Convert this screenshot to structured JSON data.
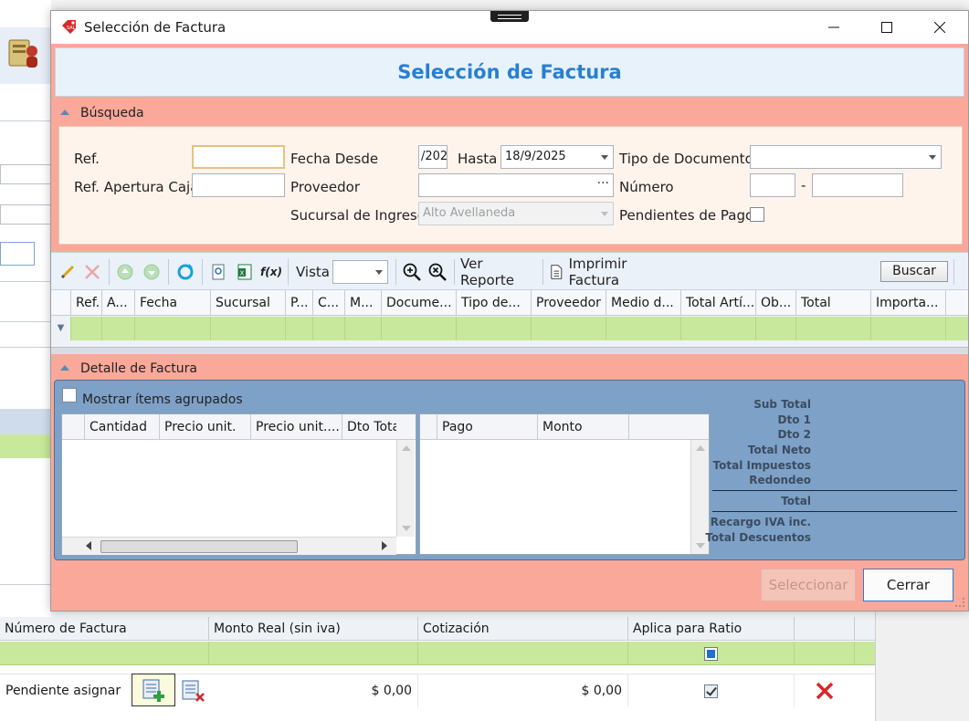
{
  "dialog": {
    "title": "Selección de Factura",
    "header": "Selección de Factura",
    "controls": {
      "minimize": "minimize",
      "maximize": "maximize",
      "close": "close"
    }
  },
  "search": {
    "section_title": "Búsqueda",
    "ref_label": "Ref.",
    "ref_value": "",
    "ref_apertura_label": "Ref. Apertura Caja",
    "ref_apertura_value": "",
    "fecha_desde_label": "Fecha Desde",
    "fecha_desde_value": "/202",
    "hasta_label": "Hasta",
    "hasta_value": "18/9/2025",
    "proveedor_label": "Proveedor",
    "proveedor_value": "",
    "proveedor_dots": "···",
    "sucursal_label": "Sucursal de Ingreso",
    "sucursal_value": "Alto Avellaneda",
    "tipo_doc_label": "Tipo de Documento",
    "tipo_doc_value": "",
    "numero_label": "Número",
    "numero_sep": "-",
    "pendientes_label": "Pendientes de Pago"
  },
  "toolbar": {
    "icons": [
      "pencil-icon",
      "delete-icon",
      "up-icon",
      "down-icon",
      "refresh-icon",
      "preview-icon",
      "excel-icon",
      "formula-icon",
      "zoom-in-icon",
      "zoom-out-icon",
      "print-icon"
    ],
    "formula_label": "f(x)",
    "vista_label": "Vista",
    "vista_value": "",
    "ver_reporte": "Ver Reporte",
    "imprimir": "Imprimir Factura",
    "buscar": "Buscar"
  },
  "invoice_grid": {
    "columns": [
      "Ref.",
      "A...",
      "Fecha",
      "Sucursal",
      "P...",
      "C...",
      "M...",
      "Docume...",
      "Tipo de...",
      "Proveedor",
      "Medio d...",
      "Total Artí...",
      "Ob...",
      "Total",
      "Importa..."
    ]
  },
  "detail": {
    "section_title": "Detalle de Factura",
    "mostrar_label": "Mostrar ítems agrupados",
    "items_columns": [
      "Cantidad",
      "Precio unit.",
      "Precio unit....",
      "Dto Tota"
    ],
    "pago_columns": [
      "Pago",
      "Monto"
    ],
    "totals": [
      "Sub Total",
      "Dto 1",
      "Dto 2",
      "Total Neto",
      "Total Impuestos",
      "Redondeo",
      "Total",
      "Recargo IVA inc.",
      "Total Descuentos"
    ]
  },
  "footer": {
    "seleccionar": "Seleccionar",
    "cerrar": "Cerrar"
  },
  "background_grid": {
    "columns": [
      "Número de Factura",
      "Monto Real (sin iva)",
      "Cotización",
      "Aplica para Ratio"
    ],
    "row": {
      "numero": "Pendiente asignar",
      "monto_real": "$ 0,00",
      "cotizacion": "$ 0,00"
    }
  }
}
